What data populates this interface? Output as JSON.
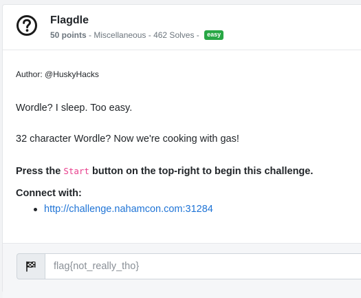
{
  "challenge": {
    "title": "Flagdle",
    "points": "50 points",
    "sep1": " - ",
    "category": "Miscellaneous",
    "sep2": " - ",
    "solves": "462 Solves",
    "sep3": " - ",
    "difficulty": "easy"
  },
  "description": {
    "author": "Author: @HuskyHacks",
    "line1": "Wordle? I sleep. Too easy.",
    "line2": "32 character Wordle? Now we're cooking with gas!",
    "press_prefix": "Press the ",
    "press_code": "Start",
    "press_suffix": " button on the top-right to begin this challenge.",
    "connect_label": "Connect with:",
    "link": "http://challenge.nahamcon.com:31284"
  },
  "submit": {
    "placeholder": "flag{not_really_tho}"
  },
  "colors": {
    "badge_easy": "#28a745",
    "link": "#1f74d6",
    "code": "#e83e8c"
  },
  "icons": {
    "header": "question-circle-icon",
    "flag_addon": "checkered-flag-icon"
  }
}
